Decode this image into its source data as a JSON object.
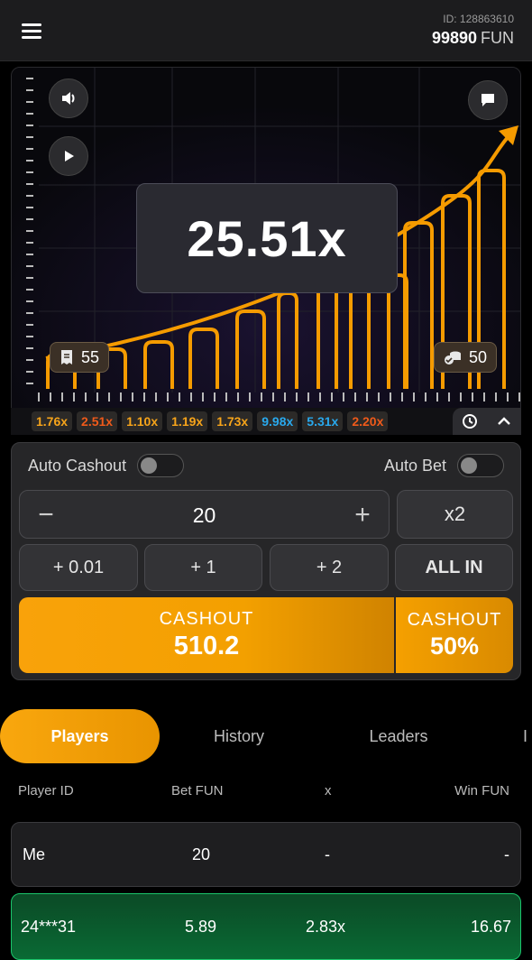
{
  "header": {
    "account_id": "ID: 128863610",
    "balance": "99890",
    "currency": "FUN"
  },
  "game": {
    "multiplier": "25.51x",
    "players_count": "55",
    "bets_count": "50",
    "bar_fill": "#f59b00"
  },
  "history": [
    {
      "value": "1.76x",
      "color": "#f7a41a"
    },
    {
      "value": "2.51x",
      "color": "#ef5a1a"
    },
    {
      "value": "1.10x",
      "color": "#f7a41a"
    },
    {
      "value": "1.19x",
      "color": "#f7a41a"
    },
    {
      "value": "1.73x",
      "color": "#f7a41a"
    },
    {
      "value": "9.98x",
      "color": "#29a8ec"
    },
    {
      "value": "5.31x",
      "color": "#29a8ec"
    },
    {
      "value": "2.20x",
      "color": "#ef5a1a"
    }
  ],
  "panel": {
    "auto_cashout_label": "Auto Cashout",
    "auto_bet_label": "Auto Bet",
    "minus": "−",
    "plus": "+",
    "amount": "20",
    "double": "x2",
    "quick": [
      "+ 0.01",
      "+ 1",
      "+ 2",
      "ALL IN"
    ],
    "cashout_label": "CASHOUT",
    "cashout_value": "510.2",
    "cashout_half_label": "CASHOUT",
    "cashout_half_value": "50%"
  },
  "tabs": [
    "Players",
    "History",
    "Leaders",
    "I"
  ],
  "table": {
    "headers": [
      "Player ID",
      "Bet  FUN",
      "x",
      "Win  FUN"
    ],
    "rows": [
      [
        "Me",
        "20",
        "-",
        "-"
      ],
      [
        "24***31",
        "5.89",
        "2.83x",
        "16.67"
      ]
    ]
  }
}
